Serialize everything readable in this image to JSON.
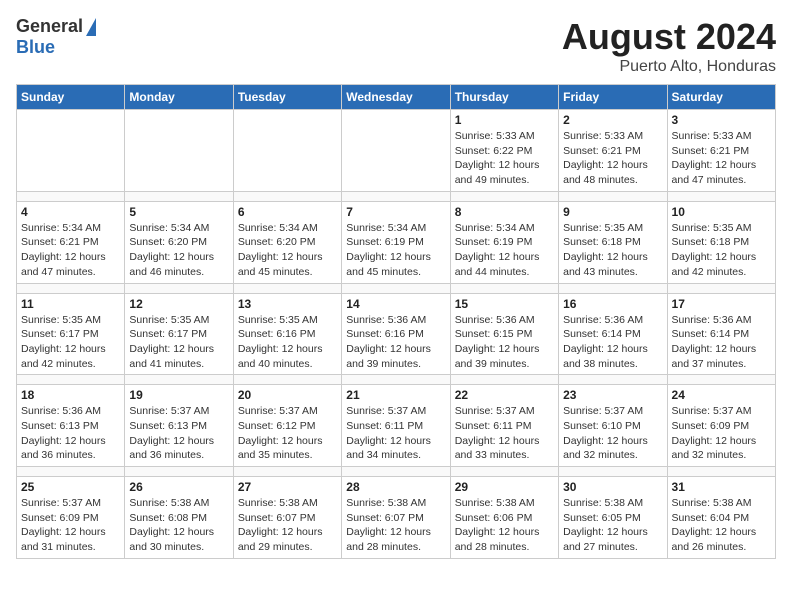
{
  "header": {
    "logo_general": "General",
    "logo_blue": "Blue",
    "title": "August 2024",
    "subtitle": "Puerto Alto, Honduras"
  },
  "calendar": {
    "days_of_week": [
      "Sunday",
      "Monday",
      "Tuesday",
      "Wednesday",
      "Thursday",
      "Friday",
      "Saturday"
    ],
    "weeks": [
      [
        {
          "day": "",
          "info": ""
        },
        {
          "day": "",
          "info": ""
        },
        {
          "day": "",
          "info": ""
        },
        {
          "day": "",
          "info": ""
        },
        {
          "day": "1",
          "info": "Sunrise: 5:33 AM\nSunset: 6:22 PM\nDaylight: 12 hours\nand 49 minutes."
        },
        {
          "day": "2",
          "info": "Sunrise: 5:33 AM\nSunset: 6:21 PM\nDaylight: 12 hours\nand 48 minutes."
        },
        {
          "day": "3",
          "info": "Sunrise: 5:33 AM\nSunset: 6:21 PM\nDaylight: 12 hours\nand 47 minutes."
        }
      ],
      [
        {
          "day": "4",
          "info": "Sunrise: 5:34 AM\nSunset: 6:21 PM\nDaylight: 12 hours\nand 47 minutes."
        },
        {
          "day": "5",
          "info": "Sunrise: 5:34 AM\nSunset: 6:20 PM\nDaylight: 12 hours\nand 46 minutes."
        },
        {
          "day": "6",
          "info": "Sunrise: 5:34 AM\nSunset: 6:20 PM\nDaylight: 12 hours\nand 45 minutes."
        },
        {
          "day": "7",
          "info": "Sunrise: 5:34 AM\nSunset: 6:19 PM\nDaylight: 12 hours\nand 45 minutes."
        },
        {
          "day": "8",
          "info": "Sunrise: 5:34 AM\nSunset: 6:19 PM\nDaylight: 12 hours\nand 44 minutes."
        },
        {
          "day": "9",
          "info": "Sunrise: 5:35 AM\nSunset: 6:18 PM\nDaylight: 12 hours\nand 43 minutes."
        },
        {
          "day": "10",
          "info": "Sunrise: 5:35 AM\nSunset: 6:18 PM\nDaylight: 12 hours\nand 42 minutes."
        }
      ],
      [
        {
          "day": "11",
          "info": "Sunrise: 5:35 AM\nSunset: 6:17 PM\nDaylight: 12 hours\nand 42 minutes."
        },
        {
          "day": "12",
          "info": "Sunrise: 5:35 AM\nSunset: 6:17 PM\nDaylight: 12 hours\nand 41 minutes."
        },
        {
          "day": "13",
          "info": "Sunrise: 5:35 AM\nSunset: 6:16 PM\nDaylight: 12 hours\nand 40 minutes."
        },
        {
          "day": "14",
          "info": "Sunrise: 5:36 AM\nSunset: 6:16 PM\nDaylight: 12 hours\nand 39 minutes."
        },
        {
          "day": "15",
          "info": "Sunrise: 5:36 AM\nSunset: 6:15 PM\nDaylight: 12 hours\nand 39 minutes."
        },
        {
          "day": "16",
          "info": "Sunrise: 5:36 AM\nSunset: 6:14 PM\nDaylight: 12 hours\nand 38 minutes."
        },
        {
          "day": "17",
          "info": "Sunrise: 5:36 AM\nSunset: 6:14 PM\nDaylight: 12 hours\nand 37 minutes."
        }
      ],
      [
        {
          "day": "18",
          "info": "Sunrise: 5:36 AM\nSunset: 6:13 PM\nDaylight: 12 hours\nand 36 minutes."
        },
        {
          "day": "19",
          "info": "Sunrise: 5:37 AM\nSunset: 6:13 PM\nDaylight: 12 hours\nand 36 minutes."
        },
        {
          "day": "20",
          "info": "Sunrise: 5:37 AM\nSunset: 6:12 PM\nDaylight: 12 hours\nand 35 minutes."
        },
        {
          "day": "21",
          "info": "Sunrise: 5:37 AM\nSunset: 6:11 PM\nDaylight: 12 hours\nand 34 minutes."
        },
        {
          "day": "22",
          "info": "Sunrise: 5:37 AM\nSunset: 6:11 PM\nDaylight: 12 hours\nand 33 minutes."
        },
        {
          "day": "23",
          "info": "Sunrise: 5:37 AM\nSunset: 6:10 PM\nDaylight: 12 hours\nand 32 minutes."
        },
        {
          "day": "24",
          "info": "Sunrise: 5:37 AM\nSunset: 6:09 PM\nDaylight: 12 hours\nand 32 minutes."
        }
      ],
      [
        {
          "day": "25",
          "info": "Sunrise: 5:37 AM\nSunset: 6:09 PM\nDaylight: 12 hours\nand 31 minutes."
        },
        {
          "day": "26",
          "info": "Sunrise: 5:38 AM\nSunset: 6:08 PM\nDaylight: 12 hours\nand 30 minutes."
        },
        {
          "day": "27",
          "info": "Sunrise: 5:38 AM\nSunset: 6:07 PM\nDaylight: 12 hours\nand 29 minutes."
        },
        {
          "day": "28",
          "info": "Sunrise: 5:38 AM\nSunset: 6:07 PM\nDaylight: 12 hours\nand 28 minutes."
        },
        {
          "day": "29",
          "info": "Sunrise: 5:38 AM\nSunset: 6:06 PM\nDaylight: 12 hours\nand 28 minutes."
        },
        {
          "day": "30",
          "info": "Sunrise: 5:38 AM\nSunset: 6:05 PM\nDaylight: 12 hours\nand 27 minutes."
        },
        {
          "day": "31",
          "info": "Sunrise: 5:38 AM\nSunset: 6:04 PM\nDaylight: 12 hours\nand 26 minutes."
        }
      ]
    ]
  }
}
